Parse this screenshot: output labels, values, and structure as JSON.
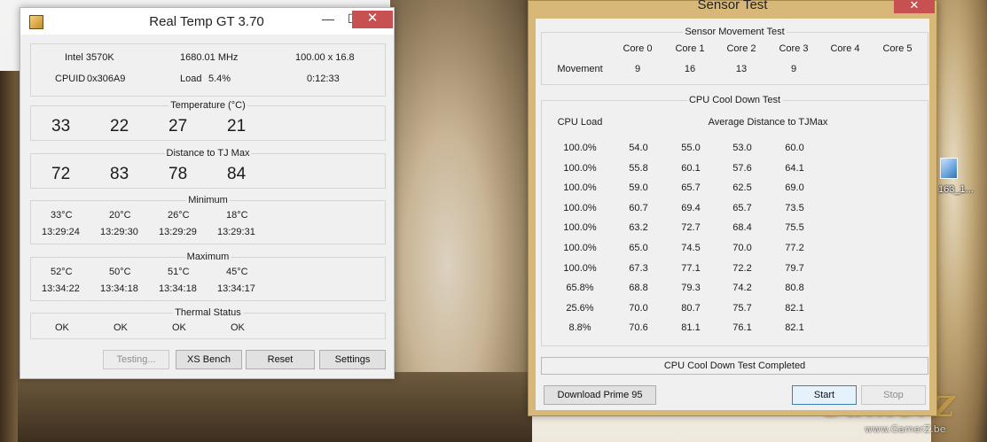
{
  "desktop": {
    "icon_label": "163_1...",
    "watermark": "GamerZ",
    "watermark_url": "www.GamerZ.be"
  },
  "realtemp": {
    "title": "Real Temp GT 3.70",
    "titlebar": {
      "minimize": "—",
      "maximize": "☐",
      "close": "✕"
    },
    "info": {
      "cpu": "Intel 3570K",
      "freq": "1680.01 MHz",
      "multiplier": "100.00 x 16.8",
      "cpuid_label": "CPUID",
      "cpuid": "0x306A9",
      "load_label": "Load",
      "load": "5.4%",
      "time": "0:12:33"
    },
    "temperature": {
      "title": "Temperature (°C)",
      "values": [
        "33",
        "22",
        "27",
        "21"
      ]
    },
    "distance": {
      "title": "Distance to TJ Max",
      "values": [
        "72",
        "83",
        "78",
        "84"
      ]
    },
    "minimum": {
      "title": "Minimum",
      "temps": [
        "33°C",
        "20°C",
        "26°C",
        "18°C"
      ],
      "times": [
        "13:29:24",
        "13:29:30",
        "13:29:29",
        "13:29:31"
      ]
    },
    "maximum": {
      "title": "Maximum",
      "temps": [
        "52°C",
        "50°C",
        "51°C",
        "45°C"
      ],
      "times": [
        "13:34:22",
        "13:34:18",
        "13:34:18",
        "13:34:17"
      ]
    },
    "thermal": {
      "title": "Thermal Status",
      "values": [
        "OK",
        "OK",
        "OK",
        "OK"
      ]
    },
    "buttons": {
      "testing": "Testing...",
      "xs_bench": "XS Bench",
      "reset": "Reset",
      "settings": "Settings"
    }
  },
  "sensortest": {
    "title": "Sensor Test",
    "close": "✕",
    "movement": {
      "title": "Sensor Movement Test",
      "cores": [
        "Core 0",
        "Core 1",
        "Core 2",
        "Core 3",
        "Core 4",
        "Core 5"
      ],
      "row_label": "Movement",
      "values": [
        "9",
        "16",
        "13",
        "9",
        "",
        ""
      ]
    },
    "cooldown": {
      "title": "CPU Cool Down Test",
      "load_header": "CPU Load",
      "dist_header": "Average Distance to TJMax",
      "rows": [
        {
          "load": "100.0%",
          "values": [
            "54.0",
            "55.0",
            "53.0",
            "60.0"
          ]
        },
        {
          "load": "100.0%",
          "values": [
            "55.8",
            "60.1",
            "57.6",
            "64.1"
          ]
        },
        {
          "load": "100.0%",
          "values": [
            "59.0",
            "65.7",
            "62.5",
            "69.0"
          ]
        },
        {
          "load": "100.0%",
          "values": [
            "60.7",
            "69.4",
            "65.7",
            "73.5"
          ]
        },
        {
          "load": "100.0%",
          "values": [
            "63.2",
            "72.7",
            "68.4",
            "75.5"
          ]
        },
        {
          "load": "100.0%",
          "values": [
            "65.0",
            "74.5",
            "70.0",
            "77.2"
          ]
        },
        {
          "load": "100.0%",
          "values": [
            "67.3",
            "77.1",
            "72.2",
            "79.7"
          ]
        },
        {
          "load": "65.8%",
          "values": [
            "68.8",
            "79.3",
            "74.2",
            "80.8"
          ]
        },
        {
          "load": "25.6%",
          "values": [
            "70.0",
            "80.7",
            "75.7",
            "82.1"
          ]
        },
        {
          "load": "8.8%",
          "values": [
            "70.6",
            "81.1",
            "76.1",
            "82.1"
          ]
        }
      ]
    },
    "status": "CPU Cool Down Test Completed",
    "buttons": {
      "download": "Download Prime 95",
      "start": "Start",
      "stop": "Stop"
    }
  }
}
